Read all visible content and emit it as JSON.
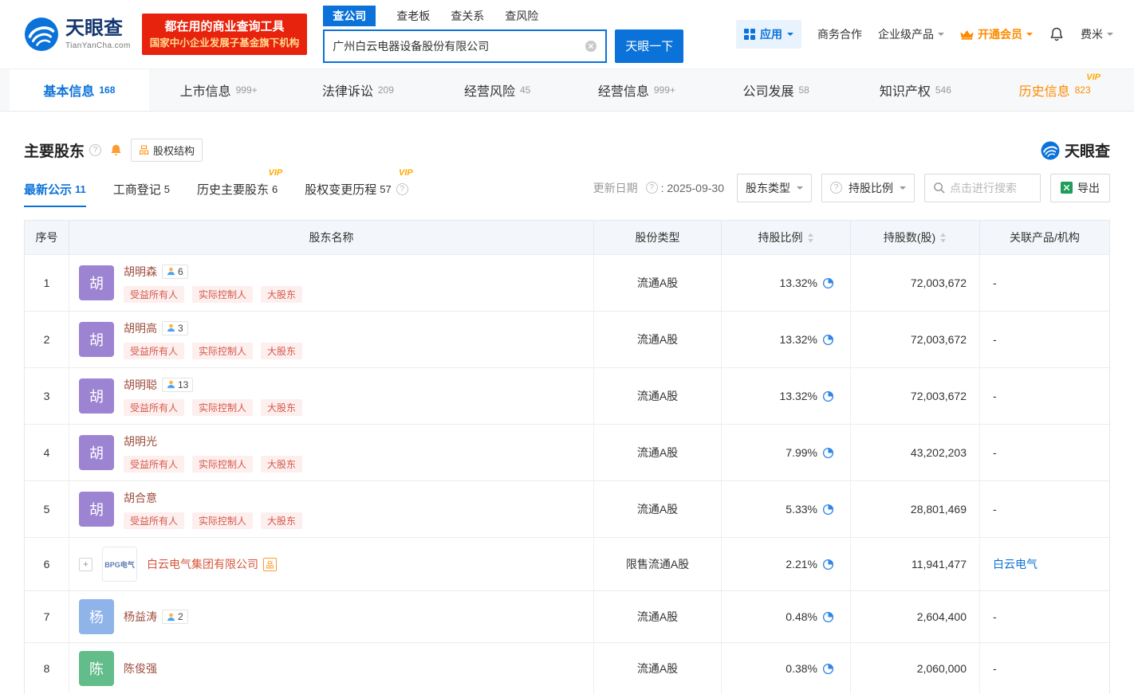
{
  "brand": {
    "name": "天眼查",
    "domain": "TianYanCha.com",
    "banner_line1": "都在用的商业查询工具",
    "banner_line2": "国家中小企业发展子基金旗下机构"
  },
  "search": {
    "tabs": [
      {
        "label": "查公司",
        "active": true
      },
      {
        "label": "查老板"
      },
      {
        "label": "查关系"
      },
      {
        "label": "查风险"
      }
    ],
    "value": "广州白云电器设备股份有限公司",
    "button": "天眼一下"
  },
  "header_right": {
    "apps": "应用",
    "partner": "商务合作",
    "enterprise": "企业级产品",
    "vip": "开通会员",
    "user": "费米"
  },
  "nav_tabs": [
    {
      "label": "基本信息",
      "count": "168",
      "active": true
    },
    {
      "label": "上市信息",
      "count": "999+"
    },
    {
      "label": "法律诉讼",
      "count": "209"
    },
    {
      "label": "经营风险",
      "count": "45"
    },
    {
      "label": "经营信息",
      "count": "999+"
    },
    {
      "label": "公司发展",
      "count": "58"
    },
    {
      "label": "知识产权",
      "count": "546"
    },
    {
      "label": "历史信息",
      "count": "823",
      "vip": true,
      "highlight": true
    }
  ],
  "section": {
    "title": "主要股东",
    "equity_button": "股权结构",
    "logo_text": "天眼查"
  },
  "subtabs": [
    {
      "label": "最新公示",
      "count": "11",
      "active": true
    },
    {
      "label": "工商登记",
      "count": "5"
    },
    {
      "label": "历史主要股东",
      "count": "6",
      "vip": true
    },
    {
      "label": "股权变更历程",
      "count": "57",
      "vip": true,
      "help": true
    }
  ],
  "controls": {
    "update_label": "更新日期",
    "update_value": ": 2025-09-30",
    "shareholder_type": "股东类型",
    "ratio_filter": "持股比例",
    "search_placeholder": "点击进行搜索",
    "export": "导出"
  },
  "vip_text": "VIP",
  "icons": {
    "equity": "品",
    "expand": "+",
    "help": "?"
  },
  "colors": {
    "primary": "#0b72d9",
    "vip_orange": "#ff8a00",
    "tag_red": "#d6584a",
    "banner_red": "#e8230d",
    "person_link": "#9d4c3d",
    "company_link": "#d6573c",
    "related_link": "#0b72d9",
    "avatar_purple": "#9d84d2",
    "avatar_blue": "#8fb4ea",
    "avatar_green": "#62bd8a"
  },
  "table": {
    "headers": [
      {
        "label": "序号"
      },
      {
        "label": "股东名称"
      },
      {
        "label": "股份类型"
      },
      {
        "label": "持股比例",
        "sortable": true
      },
      {
        "label": "持股数(股)",
        "sortable": true
      },
      {
        "label": "关联产品/机构"
      }
    ],
    "rows": [
      {
        "no": "1",
        "type": "person",
        "avatar_text": "胡",
        "avatar_color": "#9d84d2",
        "name": "胡明森",
        "badge": "6",
        "tags": [
          "受益所有人",
          "实际控制人",
          "大股东"
        ],
        "share_type": "流通A股",
        "ratio": "13.32%",
        "shares": "72,003,672",
        "related": "-"
      },
      {
        "no": "2",
        "type": "person",
        "avatar_text": "胡",
        "avatar_color": "#9d84d2",
        "name": "胡明高",
        "badge": "3",
        "tags": [
          "受益所有人",
          "实际控制人",
          "大股东"
        ],
        "share_type": "流通A股",
        "ratio": "13.32%",
        "shares": "72,003,672",
        "related": "-"
      },
      {
        "no": "3",
        "type": "person",
        "avatar_text": "胡",
        "avatar_color": "#9d84d2",
        "name": "胡明聪",
        "badge": "13",
        "tags": [
          "受益所有人",
          "实际控制人",
          "大股东"
        ],
        "share_type": "流通A股",
        "ratio": "13.32%",
        "shares": "72,003,672",
        "related": "-"
      },
      {
        "no": "4",
        "type": "person",
        "avatar_text": "胡",
        "avatar_color": "#9d84d2",
        "name": "胡明光",
        "tags": [
          "受益所有人",
          "实际控制人",
          "大股东"
        ],
        "share_type": "流通A股",
        "ratio": "7.99%",
        "shares": "43,202,203",
        "related": "-"
      },
      {
        "no": "5",
        "type": "person",
        "avatar_text": "胡",
        "avatar_color": "#9d84d2",
        "name": "胡合意",
        "tags": [
          "受益所有人",
          "实际控制人",
          "大股东"
        ],
        "share_type": "流通A股",
        "ratio": "5.33%",
        "shares": "28,801,469",
        "related": "-"
      },
      {
        "no": "6",
        "type": "company",
        "logo_text": "BPG电气",
        "name": "白云电气集团有限公司",
        "share_type": "限售流通A股",
        "ratio": "2.21%",
        "shares": "11,941,477",
        "related": "白云电气",
        "related_is_link": true
      },
      {
        "no": "7",
        "type": "person",
        "avatar_text": "杨",
        "avatar_color": "#8fb4ea",
        "name": "杨益涛",
        "badge": "2",
        "share_type": "流通A股",
        "ratio": "0.48%",
        "shares": "2,604,400",
        "related": "-"
      },
      {
        "no": "8",
        "type": "person",
        "avatar_text": "陈",
        "avatar_color": "#62bd8a",
        "name": "陈俊强",
        "share_type": "流通A股",
        "ratio": "0.38%",
        "shares": "2,060,000",
        "related": "-"
      }
    ]
  }
}
